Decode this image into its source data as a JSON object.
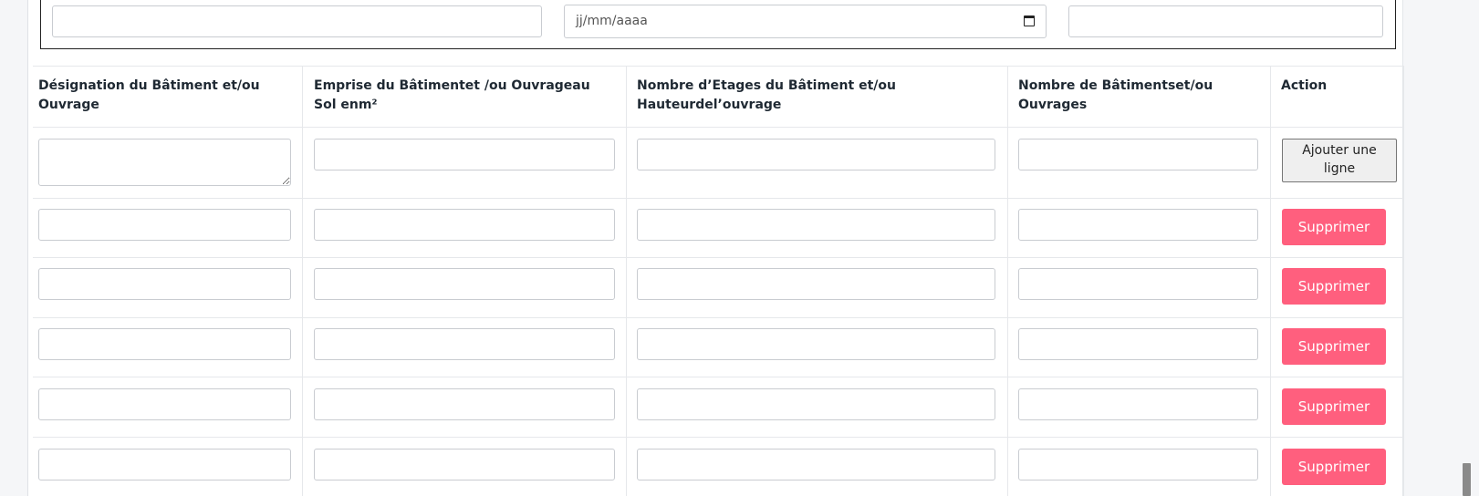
{
  "top_fields": {
    "field_1_value": "",
    "date_placeholder": "jj/mm/aaaa",
    "field_3_value": ""
  },
  "table": {
    "headers": [
      "Désignation du Bâtiment et/ou Ouvrage",
      "Emprise du Bâtimentet /ou Ouvrageau Sol enm²",
      "Nombre d’Etages du Bâtiment et/ou Hauteurdel’ouvrage",
      "Nombre de Bâtimentset/ou Ouvrages",
      "Action"
    ],
    "add_button_label": "Ajouter une ligne",
    "delete_button_label": "Supprimer",
    "delete_button_color": "#ff5f7e",
    "rows": [
      [
        "",
        "",
        "",
        ""
      ],
      [
        "",
        "",
        "",
        ""
      ],
      [
        "",
        "",
        "",
        ""
      ],
      [
        "",
        "",
        "",
        ""
      ],
      [
        "",
        "",
        "",
        ""
      ],
      [
        "",
        "",
        "",
        ""
      ]
    ]
  }
}
